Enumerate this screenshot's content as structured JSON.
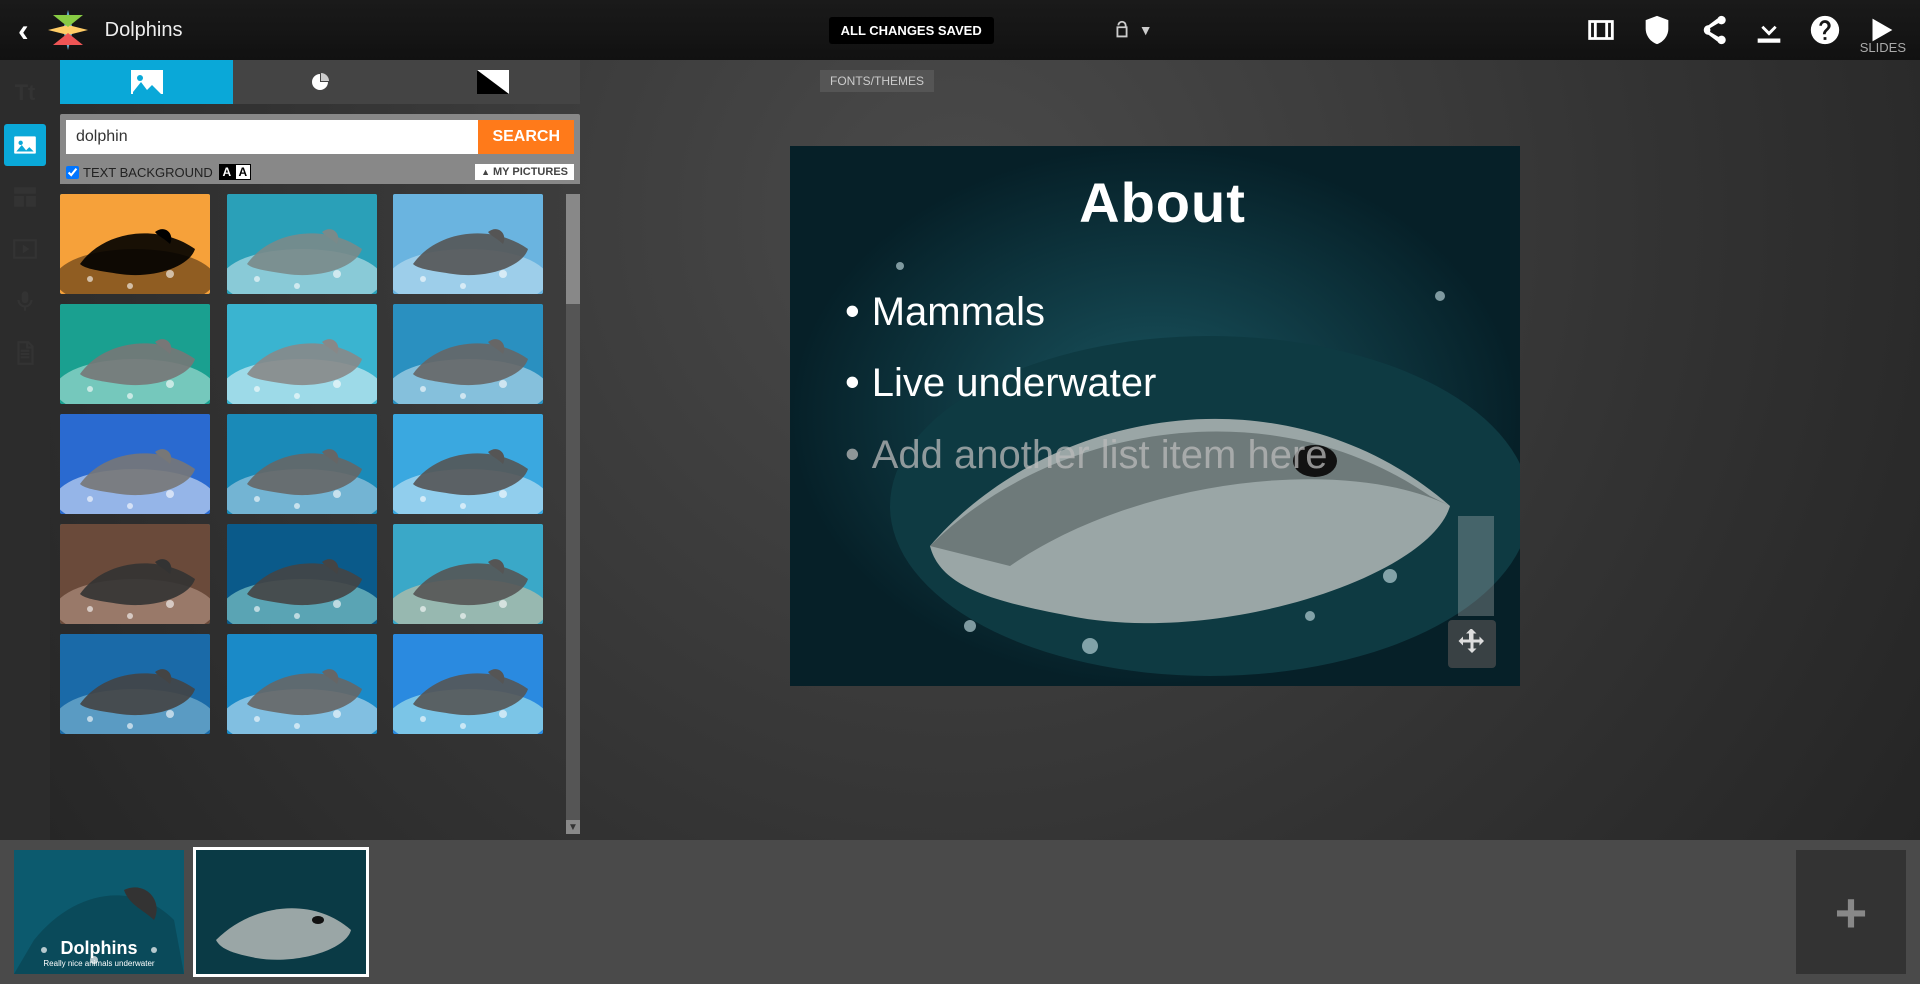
{
  "header": {
    "project_title": "Dolphins",
    "save_status": "ALL CHANGES SAVED"
  },
  "top_icons": {
    "film": "film-icon",
    "shield": "shield-icon",
    "share": "share-icon",
    "download": "download-icon",
    "help": "help-icon",
    "play": "play-icon"
  },
  "rail": {
    "text": "Tt",
    "image": "image-icon",
    "layout": "layout-icon",
    "video": "video-icon",
    "mic": "mic-icon",
    "doc": "doc-icon"
  },
  "tabs": {
    "active": 0,
    "labels": [
      "image",
      "chart",
      "bw"
    ]
  },
  "search": {
    "value": "dolphin",
    "button": "SEARCH",
    "text_background_label": "TEXT BACKGROUND",
    "text_background_checked": true,
    "aa1": "A",
    "aa2": "A",
    "my_pictures": "MY PICTURES"
  },
  "thumbs": {
    "count": 15
  },
  "canvas": {
    "fonts_themes": "FONTS/THEMES",
    "slide_title": "About",
    "bullets": [
      "Mammals",
      "Live underwater"
    ],
    "placeholder": "Add another list item here"
  },
  "footer": {
    "slides_label": "SLIDES",
    "slide1_title": "Dolphins",
    "slide1_subtitle": "Really nice animals underwater",
    "add_label": "+"
  }
}
